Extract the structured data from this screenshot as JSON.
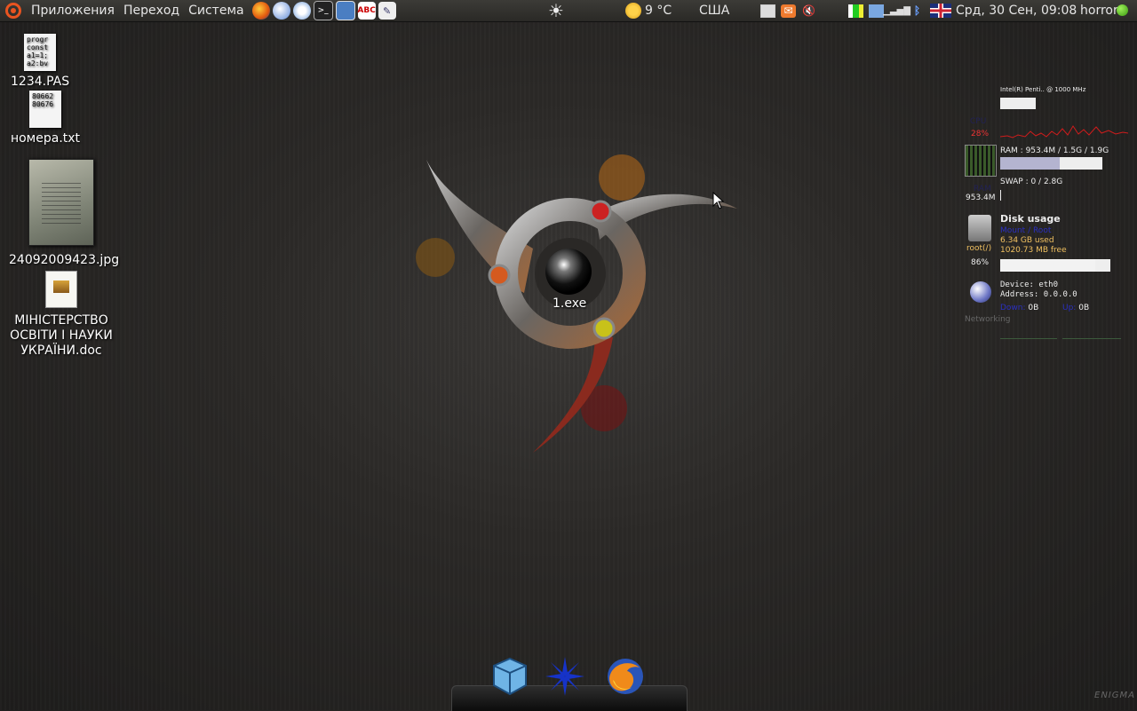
{
  "panel": {
    "menus": [
      "Приложения",
      "Переход",
      "Система"
    ],
    "weather_temp": "9 °C",
    "keyboard_layout": "США",
    "clock": "Срд, 30 Сен, 09:08",
    "user": "horror",
    "abc_icon_text": "ABC"
  },
  "desktop_icons": [
    {
      "label": "1234.PAS",
      "preview": "progr\nconst\na1=1;\na2:bv"
    },
    {
      "label": "номера.txt",
      "preview": "80662\n80676"
    },
    {
      "label": "24092009423.jpg"
    },
    {
      "label": "МІНІСТЕРСТВО ОСВІТИ І НАУКИ УКРАЇНИ.doc"
    }
  ],
  "center_icon": {
    "label": "1.exe"
  },
  "conky": {
    "cpu_name": "Intel(R) Penti.. @ 1000 MHz",
    "cpu_percent": "28%",
    "cpu_usage_fraction": 0.28,
    "ram_line": "RAM : 953.4M / 1.5G / 1.9G",
    "ram_value": "953.4M",
    "ram_fraction": 0.58,
    "swap_line": "SWAP : 0 / 2.8G",
    "disk_title": "Disk usage",
    "disk_used": "6.34 GB used",
    "disk_free": "1020.73 MB free",
    "disk_root": "root(/)",
    "disk_percent": "86%",
    "disk_fraction": 0.86,
    "net_device": "Device: eth0",
    "net_address": "Address: 0.0.0.0",
    "net_down": "0B",
    "net_up": "0B"
  },
  "watermark": "ENIGMA",
  "colors": {
    "accent_orange": "#e95420",
    "status_green": "#3a9a10",
    "cpu_graph": "#d11c1c"
  }
}
